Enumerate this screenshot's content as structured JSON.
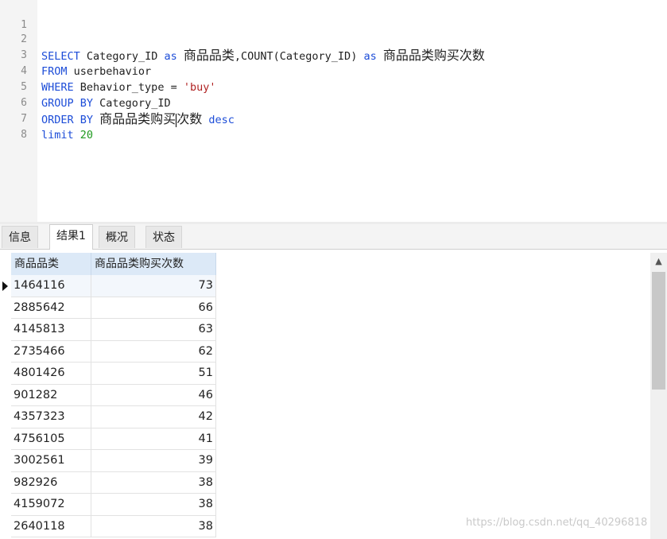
{
  "editor": {
    "line_numbers": [
      "1",
      "2",
      "3",
      "4",
      "5",
      "6",
      "7",
      "8"
    ],
    "line2": {
      "select": "SELECT",
      "col": "Category_ID",
      "as1": "as",
      "alias1": "商品品类",
      "count": ",COUNT(Category_ID)",
      "as2": "as",
      "alias2": "商品品类购买次数"
    },
    "line3": {
      "kw": "FROM",
      "table": "userbehavior"
    },
    "line4": {
      "kw": "WHERE",
      "field": "Behavior_type",
      "op": " = ",
      "value": "'buy'"
    },
    "line5": {
      "kw": "GROUP BY",
      "field": "Category_ID"
    },
    "line6": {
      "kw": "ORDER BY",
      "alias_a": "商品品类购买",
      "alias_b": "次数",
      "dir": "desc"
    },
    "line7": {
      "kw": "limit",
      "value": "20"
    }
  },
  "tabs": [
    {
      "label": "信息"
    },
    {
      "label": "结果1"
    },
    {
      "label": "概况"
    },
    {
      "label": "状态"
    }
  ],
  "grid": {
    "columns": [
      "商品品类",
      "商品品类购买次数"
    ],
    "rows": [
      [
        "1464116",
        "73"
      ],
      [
        "2885642",
        "66"
      ],
      [
        "4145813",
        "63"
      ],
      [
        "2735466",
        "62"
      ],
      [
        "4801426",
        "51"
      ],
      [
        "901282",
        "46"
      ],
      [
        "4357323",
        "42"
      ],
      [
        "4756105",
        "41"
      ],
      [
        "3002561",
        "39"
      ],
      [
        "982926",
        "38"
      ],
      [
        "4159072",
        "38"
      ],
      [
        "2640118",
        "38"
      ]
    ]
  },
  "scrollbar": {
    "up_icon": "▲"
  },
  "watermark": "https://blog.csdn.net/qq_40296818",
  "colors": {
    "keyword": "#1d4dd8",
    "string": "#b02222",
    "number": "#1f9a1f",
    "header": "#dce9f7"
  }
}
